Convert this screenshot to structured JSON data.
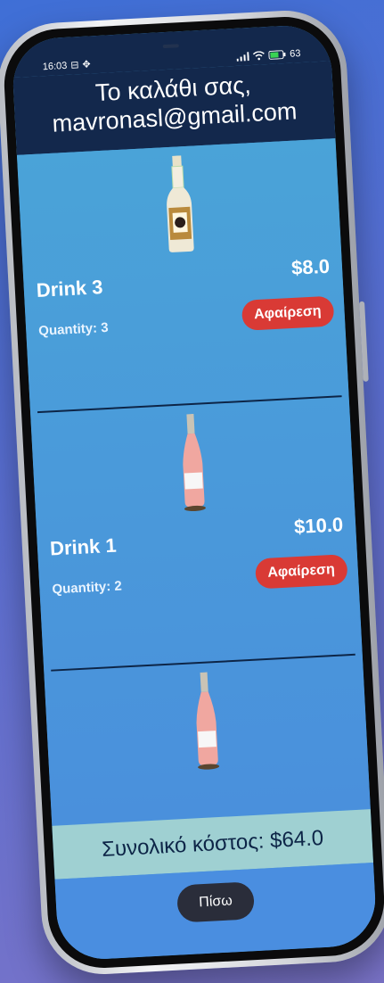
{
  "status_bar": {
    "time": "16:03",
    "left_icons": [
      "sim-icon",
      "sync-icon"
    ],
    "right_icons": [
      "signal-icon",
      "wifi-icon",
      "battery-icon"
    ],
    "battery": "63"
  },
  "header": {
    "title": "Το καλάθι σας,",
    "email": "mavronasl@gmail.com"
  },
  "cart": {
    "items": [
      {
        "name": "Drink 3",
        "price": "$8.0",
        "quantity": "Quantity: 3",
        "remove_label": "Αφαίρεση",
        "image": "vodka-bottle"
      },
      {
        "name": "Drink 1",
        "price": "$10.0",
        "quantity": "Quantity: 2",
        "remove_label": "Αφαίρεση",
        "image": "rose-champagne-bottle"
      },
      {
        "image": "rose-champagne-bottle"
      }
    ]
  },
  "total": {
    "label": "Συνολικό κόστος: $64.0"
  },
  "footer": {
    "back_label": "Πίσω"
  },
  "colors": {
    "header_bg": "#13284c",
    "list_bg": "#4a9fd6",
    "remove_button": "#d93a35",
    "total_bg": "#9fd0d2",
    "back_button": "#2a2d3a"
  }
}
